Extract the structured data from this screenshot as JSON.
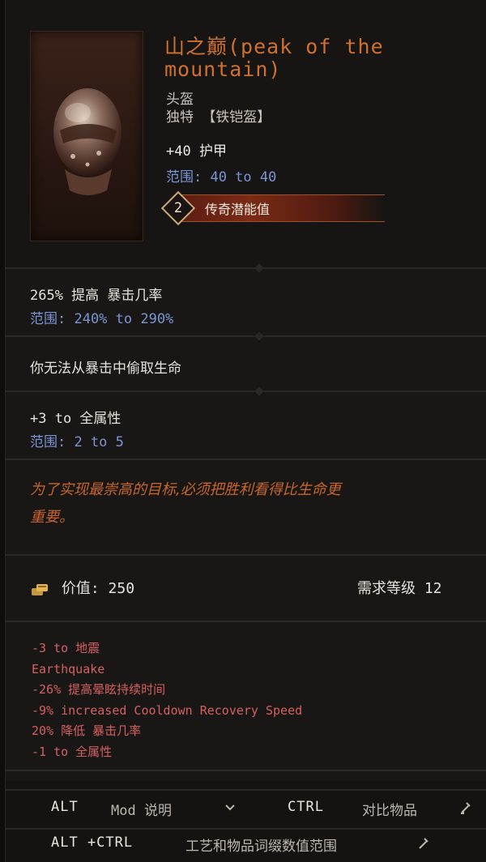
{
  "item": {
    "name": "山之巅(peak of the mountain)",
    "slot": "头盔",
    "rarity_base": "独特 【铁铠盔】",
    "armor_stat": "+40 护甲",
    "armor_range": "范围: 40 to 40",
    "legendary_potential_count": "2",
    "legendary_potential_label": "传奇潜能值"
  },
  "affixes": [
    {
      "text": "265% 提高 暴击几率",
      "range": "范围: 240% to 290%"
    },
    {
      "text": "你无法从暴击中偷取生命",
      "range": ""
    },
    {
      "text": "+3 to 全属性",
      "range": "范围: 2 to 5"
    }
  ],
  "flavor": {
    "line1": "为了实现最崇高的目标,必须把胜利看得比生命更",
    "line2": "重要。"
  },
  "value": {
    "label": "价值: 250",
    "requirement": "需求等级 12"
  },
  "corruption_mods": [
    "-3 to 地震",
    "Earthquake",
    "-26% 提高晕眩持续时间",
    "-9% increased Cooldown Recovery Speed",
    "20% 降低 暴击几率",
    "-1 to 全属性"
  ],
  "footer": {
    "row1": {
      "key1": "ALT",
      "action1": "Mod 说明",
      "key2": "CTRL",
      "action2": "对比物品"
    },
    "row2": {
      "key": "ALT +CTRL",
      "action": "工艺和物品词缀数值范围"
    }
  },
  "icons": {
    "helmet": "helmet-icon",
    "coin": "coin-icon",
    "chevron": "chevron-down-icon",
    "compare": "compare-icon",
    "range": "range-icon"
  },
  "colors": {
    "title": "#d0702e",
    "range": "#7b94d4",
    "negative": "#d46060",
    "flavor": "#c9652c"
  }
}
